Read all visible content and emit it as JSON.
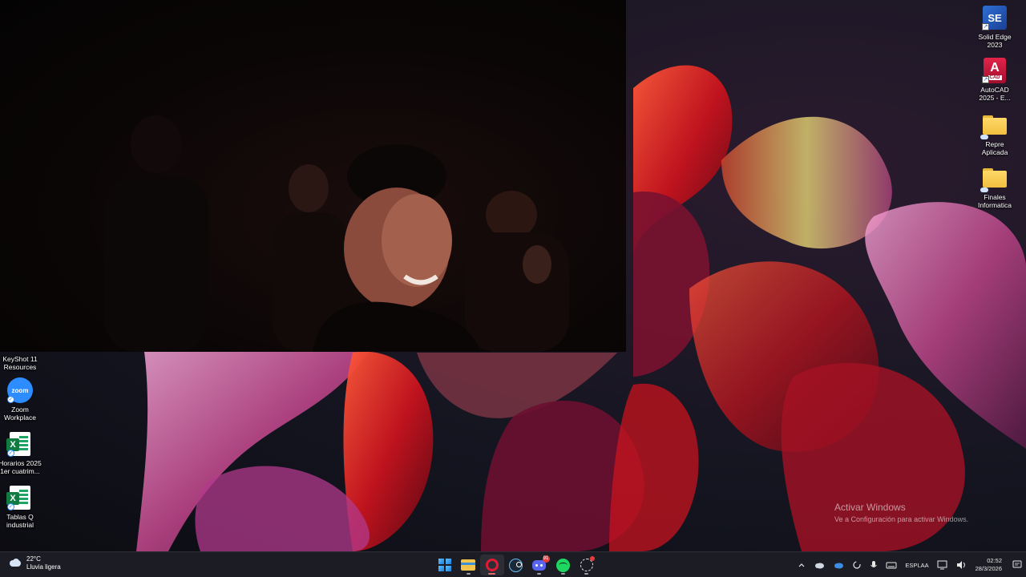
{
  "desktop_icons_right": [
    {
      "label": "Solid Edge\n2023",
      "icon": "solid-edge-icon",
      "glyph": "SE"
    },
    {
      "label": "AutoCAD\n2025 - E...",
      "icon": "autocad-icon",
      "glyph": "A",
      "sub": "CAD"
    },
    {
      "label": "Repre\nAplicada",
      "icon": "folder-icon"
    },
    {
      "label": "Finales\nInformatica",
      "icon": "folder-icon"
    }
  ],
  "desktop_icons_left": [
    {
      "label": "KeyShot 11\nResources",
      "icon": "keyshot-folder-icon"
    },
    {
      "label": "Zoom\nWorkplace",
      "icon": "zoom-icon",
      "glyph": "zoom"
    },
    {
      "label": "Horarios 2025\n1er cuatrim...",
      "icon": "excel-icon",
      "glyph": "X"
    },
    {
      "label": "Tablas Q\nindustrial",
      "icon": "excel-icon",
      "glyph": "X"
    }
  ],
  "activation": {
    "title": "Activar Windows",
    "subtitle": "Ve a Configuración para activar Windows."
  },
  "taskbar": {
    "weather": {
      "temp": "22°C",
      "desc": "Lluvia ligera"
    },
    "apps": [
      {
        "name": "start",
        "icon": "windows-start-icon"
      },
      {
        "name": "file-explorer",
        "icon": "file-explorer-icon"
      },
      {
        "name": "opera",
        "icon": "opera-icon",
        "active": true
      },
      {
        "name": "steam",
        "icon": "steam-icon"
      },
      {
        "name": "discord",
        "icon": "discord-icon",
        "badge": "91"
      },
      {
        "name": "spotify",
        "icon": "spotify-icon"
      },
      {
        "name": "chatgpt",
        "icon": "chatgpt-icon",
        "badge": ""
      }
    ],
    "tray": {
      "lang_top": "ESP",
      "lang_bottom": "LAA",
      "time": "02:52",
      "date": "28/3/2026"
    }
  },
  "colors": {
    "taskbar_bg": "#1c1d24",
    "accent": "#e21b35"
  }
}
